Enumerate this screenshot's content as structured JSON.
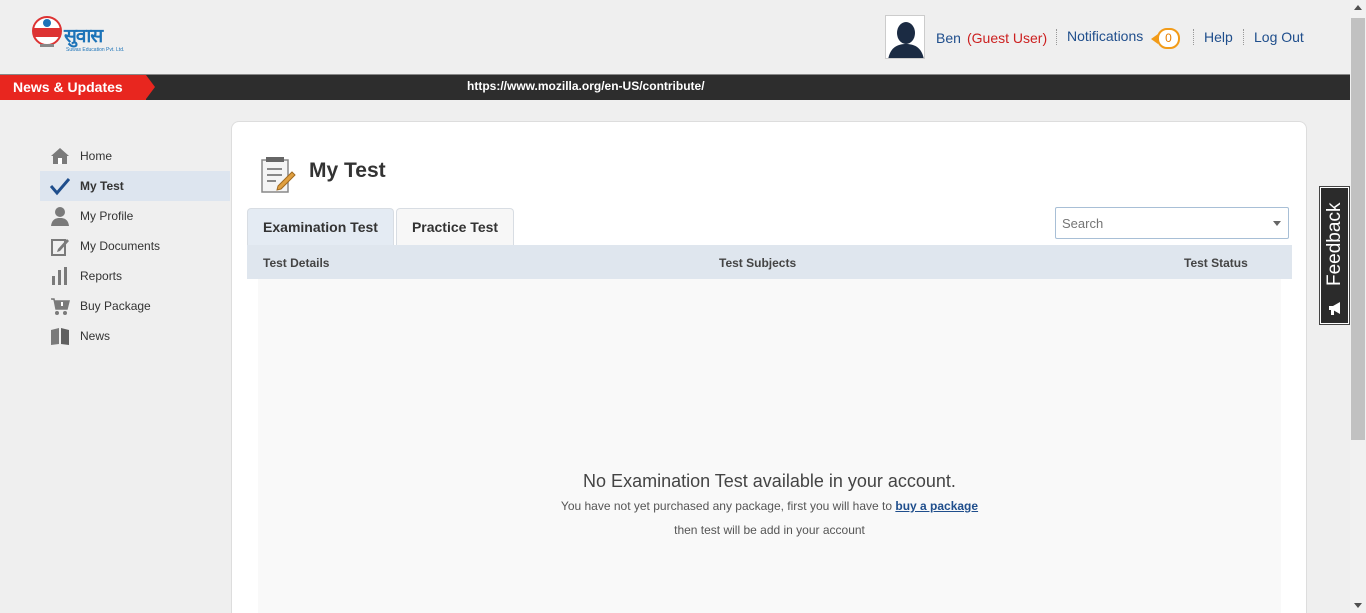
{
  "header": {
    "logo_text": "सुवास",
    "logo_sub": "Suwas Education Pvt. Ltd.",
    "user_name": "Ben",
    "user_role": "(Guest User)",
    "notifications_label": "Notifications",
    "notifications_count": "0",
    "help_label": "Help",
    "logout_label": "Log Out"
  },
  "newsbar": {
    "label": "News & Updates",
    "ticker": "https://www.mozilla.org/en-US/contribute/"
  },
  "sidebar": {
    "items": [
      {
        "label": "Home",
        "icon": "home-icon"
      },
      {
        "label": "My Test",
        "icon": "checkmark-icon"
      },
      {
        "label": "My Profile",
        "icon": "user-icon"
      },
      {
        "label": "My Documents",
        "icon": "edit-document-icon"
      },
      {
        "label": "Reports",
        "icon": "bar-chart-icon"
      },
      {
        "label": "Buy Package",
        "icon": "cart-icon"
      },
      {
        "label": "News",
        "icon": "book-icon"
      }
    ],
    "active_index": 1
  },
  "main": {
    "title": "My Test",
    "tabs": [
      {
        "label": "Examination Test",
        "active": true
      },
      {
        "label": "Practice Test",
        "active": false
      }
    ],
    "search_placeholder": "Search",
    "columns": [
      "Test Details",
      "Test Subjects",
      "Test Status"
    ],
    "empty": {
      "title": "No Examination Test available in your account.",
      "line1_prefix": "You have not yet purchased any package, first you will have to ",
      "line1_link": "buy a package",
      "line2": "then test will be add in your account"
    }
  },
  "feedback": {
    "label": "Feedback"
  },
  "colors": {
    "accent_red": "#e8261f",
    "link_blue": "#1f4e8c",
    "badge_orange": "#f29b18"
  }
}
